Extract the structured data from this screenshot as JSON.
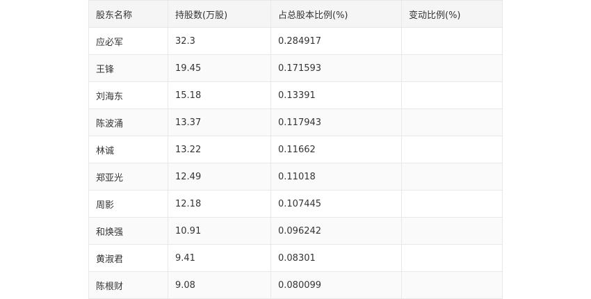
{
  "table": {
    "headers": [
      "股东名称",
      "持股数(万股)",
      "占总股本比例(%)",
      "变动比例(%)"
    ],
    "rows": [
      [
        "应必军",
        "32.3",
        "0.284917",
        ""
      ],
      [
        "王锋",
        "19.45",
        "0.171593",
        ""
      ],
      [
        "刘海东",
        "15.18",
        "0.13391",
        ""
      ],
      [
        "陈波涌",
        "13.37",
        "0.117943",
        ""
      ],
      [
        "林诚",
        "13.22",
        "0.11662",
        ""
      ],
      [
        "郑亚光",
        "12.49",
        "0.11018",
        ""
      ],
      [
        "周影",
        "12.18",
        "0.107445",
        ""
      ],
      [
        "和焕强",
        "10.91",
        "0.096242",
        ""
      ],
      [
        "黄淑君",
        "9.41",
        "0.08301",
        ""
      ],
      [
        "陈根财",
        "9.08",
        "0.080099",
        ""
      ]
    ]
  }
}
